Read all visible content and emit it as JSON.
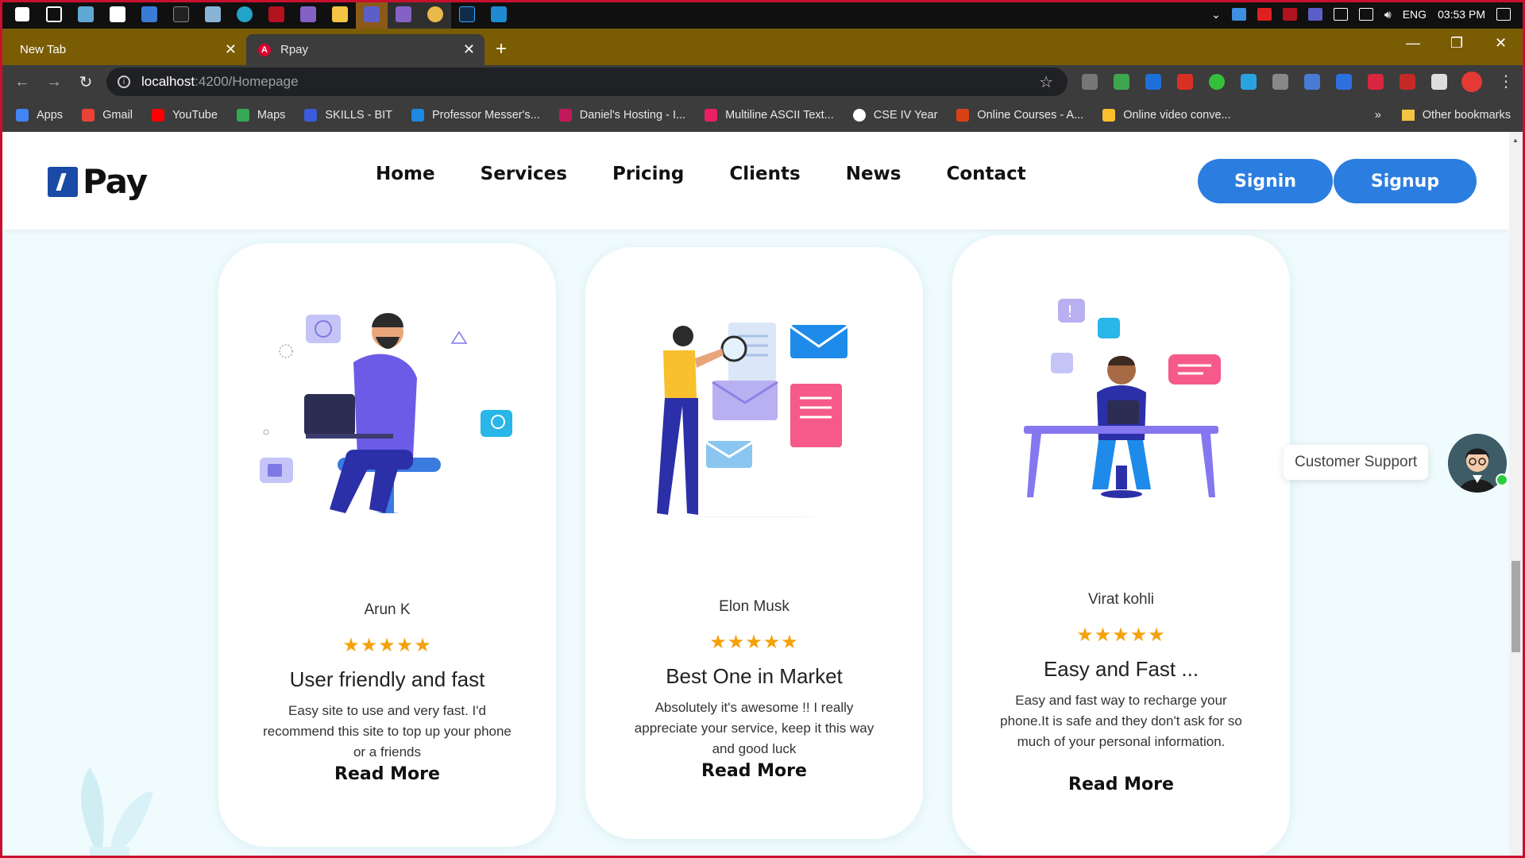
{
  "taskbar": {
    "lang": "ENG",
    "time": "03:53 PM"
  },
  "tabs": [
    {
      "label": "New Tab",
      "active": false
    },
    {
      "label": "Rpay",
      "active": true
    }
  ],
  "address": {
    "host": "localhost",
    "path": ":4200/Homepage"
  },
  "bookmarks": [
    {
      "label": "Apps",
      "icon": "apps-grid-icon",
      "color": "#4285f4"
    },
    {
      "label": "Gmail",
      "icon": "gmail-icon",
      "color": "#ea4335"
    },
    {
      "label": "YouTube",
      "icon": "youtube-icon",
      "color": "#ff0000"
    },
    {
      "label": "Maps",
      "icon": "maps-icon",
      "color": "#34a853"
    },
    {
      "label": "SKILLS - BIT",
      "icon": "skills-icon",
      "color": "#3b5bdb"
    },
    {
      "label": "Professor Messer's...",
      "icon": "professor-messer-icon",
      "color": "#1e88e5"
    },
    {
      "label": "Daniel's Hosting - I...",
      "icon": "raspberry-icon",
      "color": "#c2185b"
    },
    {
      "label": "Multiline ASCII Text...",
      "icon": "ascii-text-icon",
      "color": "#e91e63"
    },
    {
      "label": "CSE IV Year",
      "icon": "google-icon",
      "color": "#ffffff"
    },
    {
      "label": "Online Courses - A...",
      "icon": "online-courses-icon",
      "color": "#d84315"
    },
    {
      "label": "Online video conve...",
      "icon": "video-converter-icon",
      "color": "#fbc02d"
    }
  ],
  "bookmarks_more": "»",
  "other_bookmarks": "Other bookmarks",
  "site": {
    "logo": "Pay",
    "nav": [
      "Home",
      "Services",
      "Pricing",
      "Clients",
      "News",
      "Contact"
    ],
    "signin": "Signin",
    "signup": "Signup"
  },
  "cards": [
    {
      "name": "Arun K",
      "stars": "★★★★★",
      "rating": 5,
      "title": "User friendly and fast",
      "desc": "Easy site to use and very fast. I'd recommend this site to top up your phone or a friends",
      "more": "Read More"
    },
    {
      "name": "Elon Musk",
      "stars": "★★★★★",
      "rating": 5,
      "title": "Best One in Market",
      "desc": "Absolutely it's awesome !! I really appreciate your service, keep it this way and good luck",
      "more": "Read More"
    },
    {
      "name": "Virat kohli",
      "stars": "★★★★★",
      "rating": 5,
      "title": "Easy and Fast ...",
      "desc": "Easy and fast way to recharge your phone.It is safe and they don't ask for so much of your personal information.",
      "more": "Read More"
    }
  ],
  "support": {
    "label": "Customer Support"
  },
  "colors": {
    "accent": "#2b7de0",
    "star": "#f5a10a",
    "tabstrip": "#7a5c05",
    "page_bg": "#f0fbfd"
  }
}
